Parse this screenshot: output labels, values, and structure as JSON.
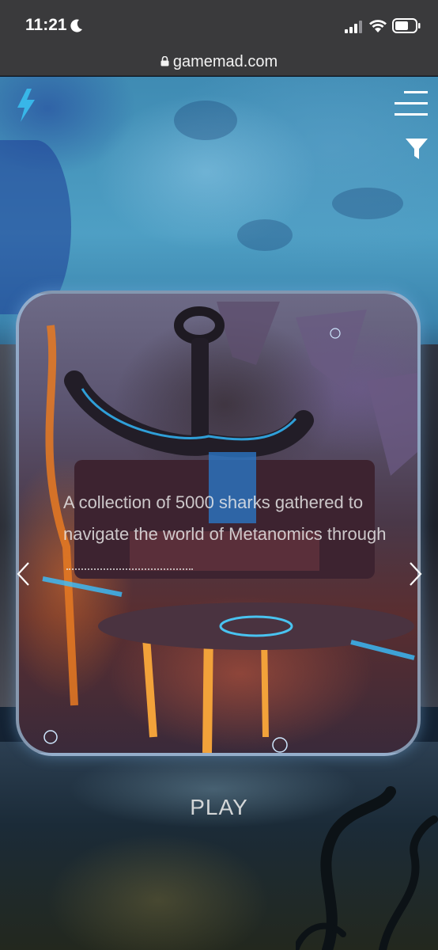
{
  "status_bar": {
    "time": "11:21"
  },
  "browser": {
    "url": "gamemad.com"
  },
  "card": {
    "description": "A collection of 5000 sharks gathered to navigate the world of Metanomics through"
  },
  "actions": {
    "play_label": "PLAY"
  },
  "colors": {
    "accent": "#38b6e8",
    "status_bar_bg": "#3a3a3c",
    "card_border": "#aad2f0"
  },
  "icons": [
    "moon-icon",
    "signal-icon",
    "wifi-icon",
    "battery-icon",
    "lock-icon",
    "lightning-logo-icon",
    "hamburger-menu-icon",
    "filter-icon",
    "chevron-left-icon",
    "chevron-right-icon"
  ]
}
